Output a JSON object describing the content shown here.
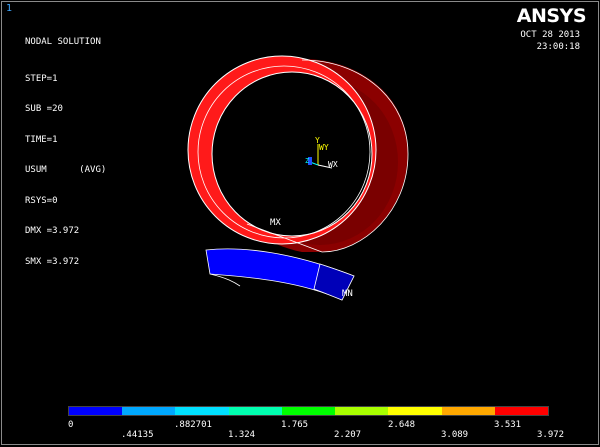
{
  "window_number": "1",
  "title": "NODAL SOLUTION",
  "info": {
    "step": "STEP=1",
    "sub": "SUB =20",
    "time": "TIME=1",
    "usum": "USUM      (AVG)",
    "rsys": "RSYS=0",
    "dmx": "DMX =3.972",
    "smx": "SMX =3.972"
  },
  "brand": "ANSYS",
  "date": "OCT 28 2013",
  "clock": "23:00:18",
  "markers": {
    "max": "MX",
    "min": "MN"
  },
  "triad": {
    "y": "Y",
    "wy": "WY",
    "wx": "WX",
    "z": "Z"
  },
  "colors": {
    "background": "#000000",
    "max_color": "#ff1a1a",
    "min_color": "#0000ff"
  },
  "legend": {
    "colors": [
      "#0000ff",
      "#00a8ff",
      "#00e0ff",
      "#00ffb0",
      "#00ff00",
      "#a8ff00",
      "#ffff00",
      "#ffa800",
      "#ff0000"
    ],
    "labels_top": [
      "0",
      ".882701",
      "1.765",
      "2.648",
      "3.531"
    ],
    "labels_bottom": [
      ".44135",
      "1.324",
      "2.207",
      "3.089",
      "3.972"
    ]
  }
}
